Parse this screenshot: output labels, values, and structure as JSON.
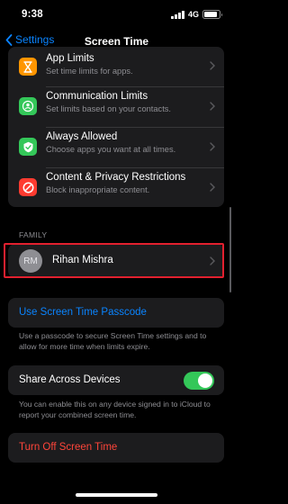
{
  "status_bar": {
    "time": "9:38",
    "network": "4G",
    "battery_level": 0.85
  },
  "nav": {
    "back_label": "Settings",
    "title": "Screen Time"
  },
  "limits": [
    {
      "title": "App Limits",
      "subtitle": "Set time limits for apps.",
      "icon": "hourglass-icon",
      "color": "#ff9500"
    },
    {
      "title": "Communication Limits",
      "subtitle": "Set limits based on your contacts.",
      "icon": "person-bubble-icon",
      "color": "#34c759"
    },
    {
      "title": "Always Allowed",
      "subtitle": "Choose apps you want at all times.",
      "icon": "checkmark-icon",
      "color": "#34c759"
    },
    {
      "title": "Content & Privacy Restrictions",
      "subtitle": "Block inappropriate content.",
      "icon": "no-entry-icon",
      "color": "#ff3b30"
    }
  ],
  "family": {
    "header": "FAMILY",
    "member_initials": "RM",
    "member_name": "Rihan Mishra"
  },
  "passcode": {
    "label": "Use Screen Time Passcode",
    "note": "Use a passcode to secure Screen Time settings and to allow for more time when limits expire."
  },
  "share": {
    "label": "Share Across Devices",
    "enabled": true,
    "note": "You can enable this on any device signed in to iCloud to report your combined screen time."
  },
  "turn_off": {
    "label": "Turn Off Screen Time"
  },
  "colors": {
    "accent": "#0a84ff",
    "destructive": "#ff453a",
    "toggle_on": "#34c759",
    "highlight": "#e2202f"
  }
}
